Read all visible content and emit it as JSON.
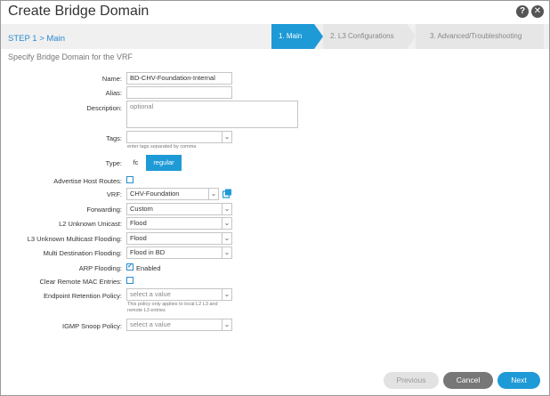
{
  "window": {
    "title": "Create Bridge Domain",
    "help_icon": "?",
    "close_icon": "✕"
  },
  "wizard": {
    "step_label": "STEP 1 > Main",
    "steps": [
      "1. Main",
      "2. L3 Configurations",
      "3. Advanced/Troubleshooting"
    ],
    "subtitle": "Specify Bridge Domain for the VRF"
  },
  "form": {
    "name": {
      "label": "Name:",
      "value": "BD-CHV-Foundation-Internal"
    },
    "alias": {
      "label": "Alias:",
      "value": ""
    },
    "description": {
      "label": "Description:",
      "placeholder": "optional"
    },
    "tags": {
      "label": "Tags:",
      "value": "",
      "hint": "enter tags separated by comma"
    },
    "type": {
      "label": "Type:",
      "options": [
        "fc",
        "regular"
      ],
      "selected": "regular"
    },
    "advertise_host_routes": {
      "label": "Advertise Host Routes:",
      "checked": false
    },
    "vrf": {
      "label": "VRF:",
      "value": "CHV-Foundation"
    },
    "forwarding": {
      "label": "Forwarding:",
      "value": "Custom"
    },
    "l2_unknown_unicast": {
      "label": "L2 Unknown Unicast:",
      "value": "Flood"
    },
    "l3_unknown_multicast": {
      "label": "L3 Unknown Multicast Flooding:",
      "value": "Flood"
    },
    "multi_destination": {
      "label": "Multi Destination Flooding:",
      "value": "Flood in BD"
    },
    "arp_flooding": {
      "label": "ARP Flooding:",
      "checked": true,
      "text": "Enabled"
    },
    "clear_remote_mac": {
      "label": "Clear Remote MAC Entries:",
      "checked": false
    },
    "endpoint_retention": {
      "label": "Endpoint Retention Policy:",
      "placeholder": "select a value",
      "hint_line1": "This policy only applies to local L2 L3 and",
      "hint_line2": "remote L3 entries"
    },
    "igmp_snoop": {
      "label": "IGMP Snoop Policy:",
      "placeholder": "select a value"
    }
  },
  "footer": {
    "previous": "Previous",
    "cancel": "Cancel",
    "next": "Next"
  },
  "colors": {
    "accent": "#1e9ad6",
    "step_link": "#2a8ad0"
  }
}
